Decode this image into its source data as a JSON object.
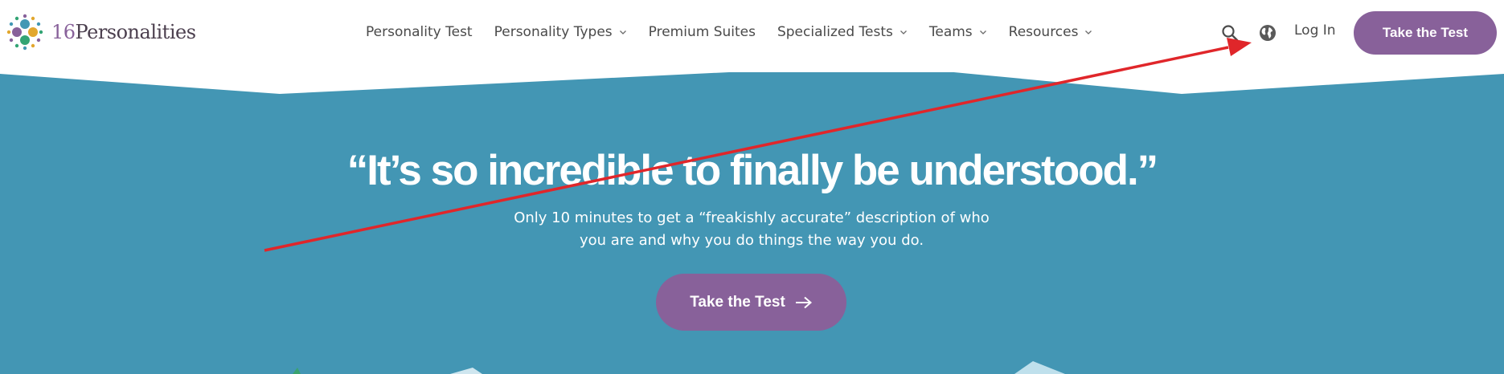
{
  "colors": {
    "brand_purple": "#88619a",
    "hero_blue": "#4396b4",
    "annotation_red": "#e0262a"
  },
  "logo": {
    "number": "16",
    "name": "Personalities"
  },
  "nav": {
    "items": [
      {
        "label": "Personality Test",
        "has_dropdown": false
      },
      {
        "label": "Personality Types",
        "has_dropdown": true
      },
      {
        "label": "Premium Suites",
        "has_dropdown": false
      },
      {
        "label": "Specialized Tests",
        "has_dropdown": true
      },
      {
        "label": "Teams",
        "has_dropdown": true
      },
      {
        "label": "Resources",
        "has_dropdown": true
      }
    ],
    "icons": [
      "search-icon",
      "globe-icon",
      "chevron-down-icon"
    ],
    "login_label": "Log In",
    "cta_label": "Take the Test"
  },
  "hero": {
    "title": "“It’s so incredible to finally be understood.”",
    "subtitle": "Only 10 minutes to get a “freakishly accurate” description of who you are and why you do things the way you do.",
    "cta_label": "Take the Test",
    "cta_icon": "arrow-right-icon"
  },
  "annotation": {
    "type": "red-arrow",
    "points_to": "globe-icon"
  }
}
